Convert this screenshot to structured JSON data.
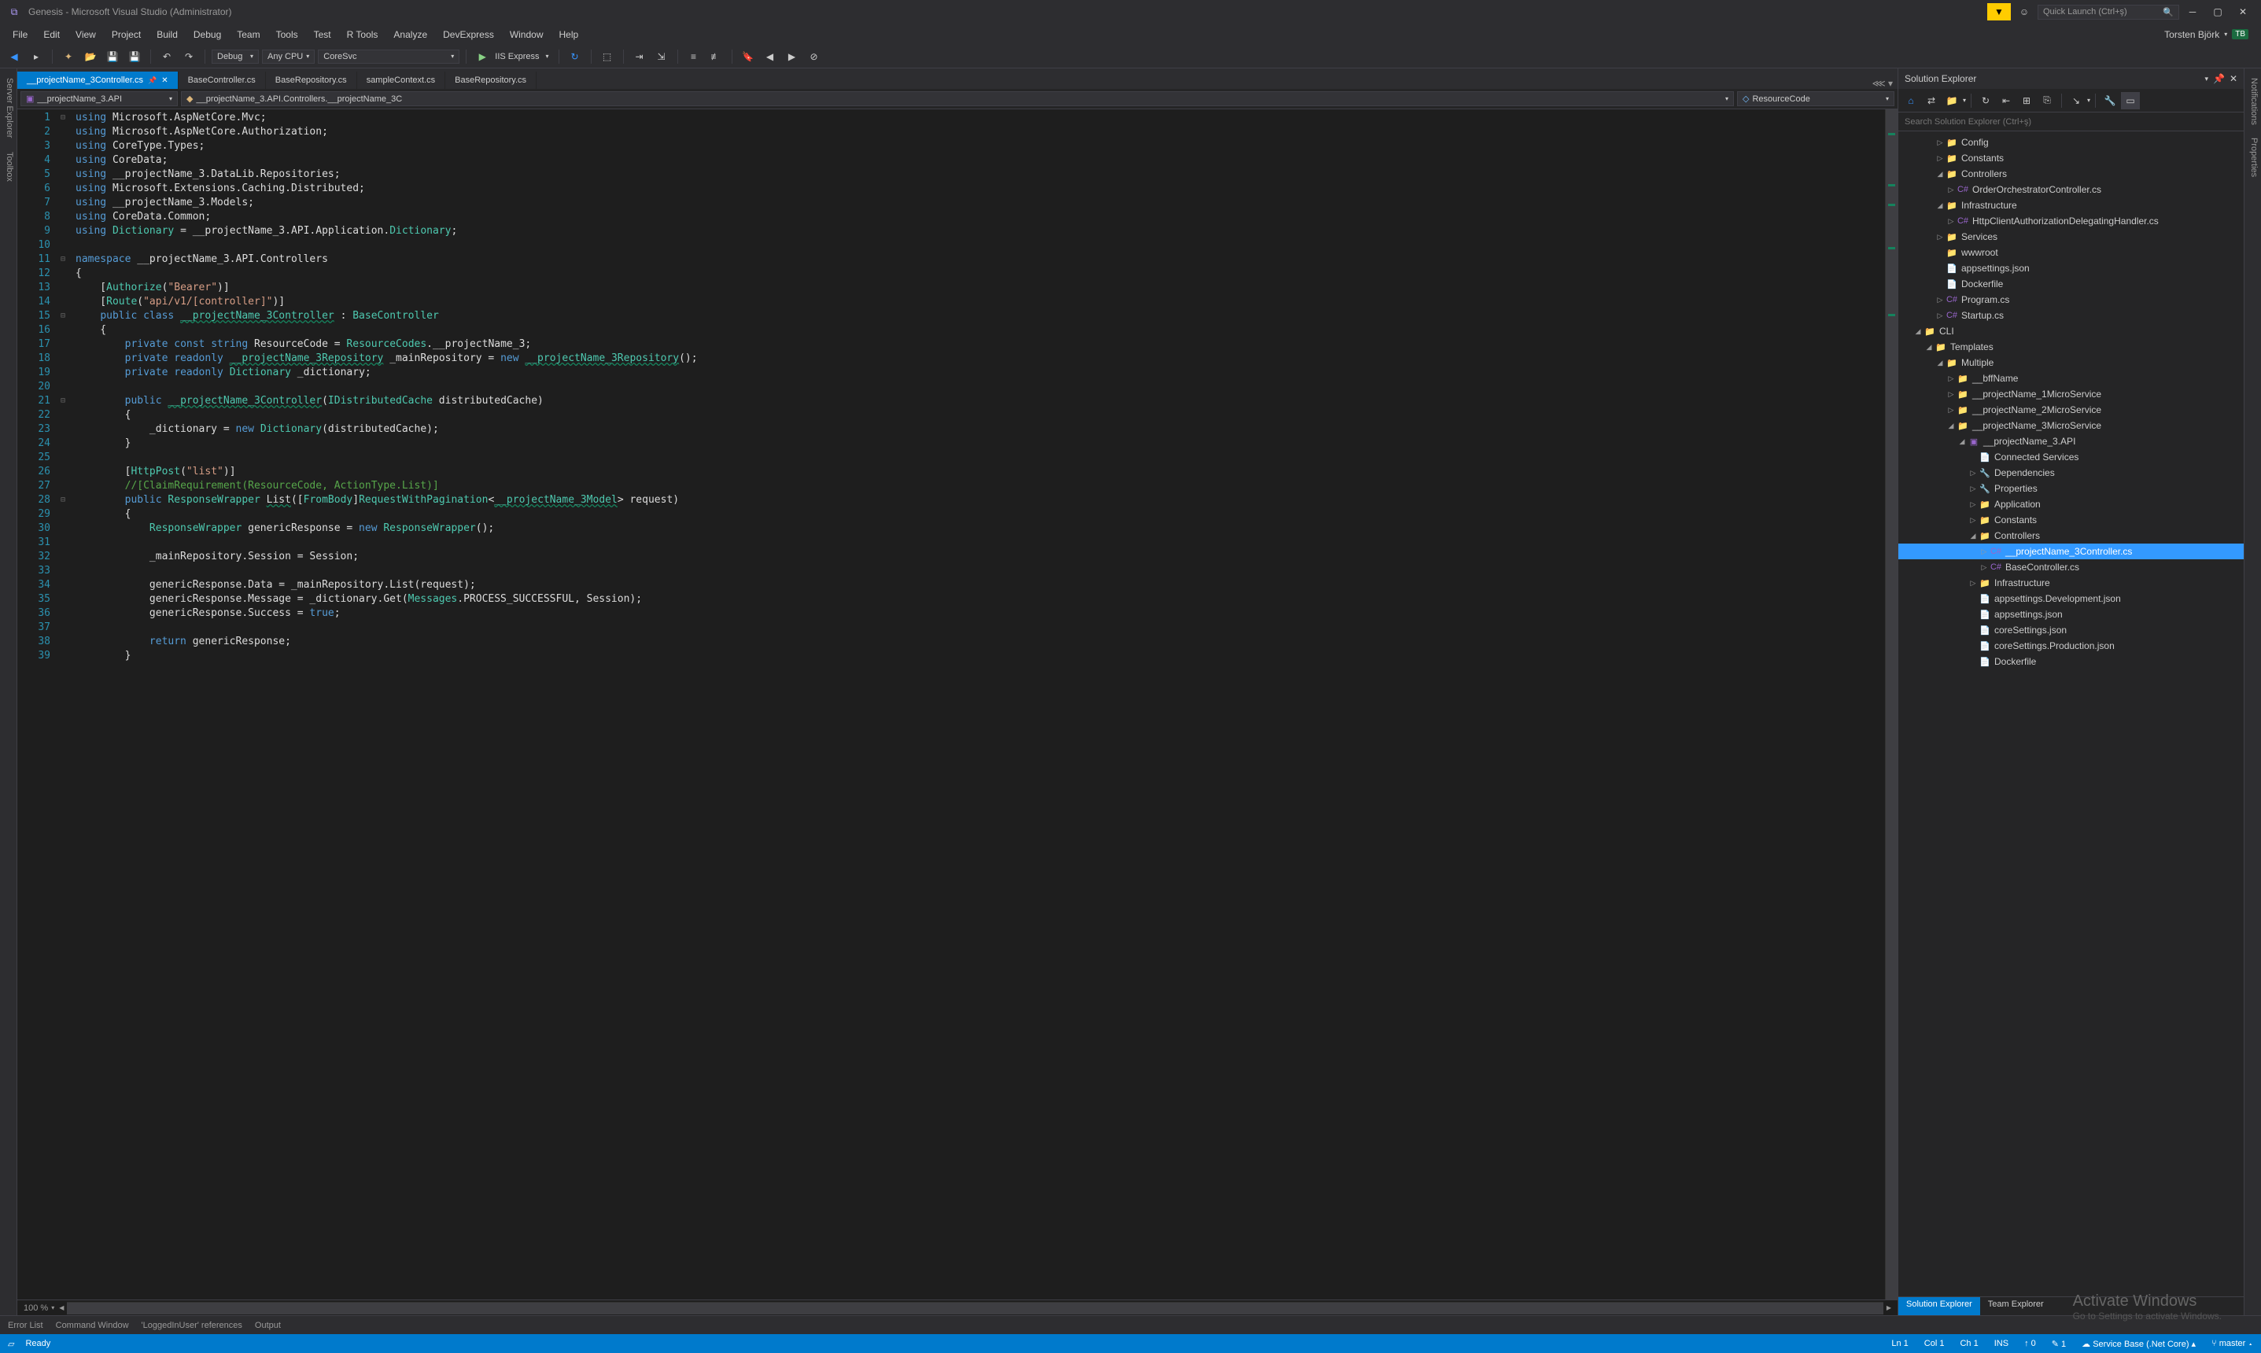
{
  "window": {
    "title": "Genesis - Microsoft Visual Studio  (Administrator)",
    "quick_launch_placeholder": "Quick Launch (Ctrl+ş)",
    "user_name": "Torsten Björk",
    "user_badge": "TB"
  },
  "menu": {
    "items": [
      "File",
      "Edit",
      "View",
      "Project",
      "Build",
      "Debug",
      "Team",
      "Tools",
      "Test",
      "R Tools",
      "Analyze",
      "DevExpress",
      "Window",
      "Help"
    ]
  },
  "toolbar": {
    "config": "Debug",
    "platform": "Any CPU",
    "startup_project": "CoreSvc",
    "run_label": "IIS Express"
  },
  "docs": {
    "tabs": [
      {
        "label": "__projectName_3Controller.cs",
        "active": true,
        "pinned": true
      },
      {
        "label": "BaseController.cs",
        "active": false
      },
      {
        "label": "BaseRepository.cs",
        "active": false
      },
      {
        "label": "sampleContext.cs",
        "active": false
      },
      {
        "label": "BaseRepository.cs",
        "active": false
      }
    ]
  },
  "navbar": {
    "scope": "__projectName_3.API",
    "class": "__projectName_3.API.Controllers.__projectName_3C",
    "member": "ResourceCode"
  },
  "code": {
    "lines": [
      {
        "n": 1,
        "fold": "⊟",
        "html": "<span class='kw'>using</span> Microsoft.AspNetCore.Mvc;"
      },
      {
        "n": 2,
        "html": "<span class='kw'>using</span> Microsoft.AspNetCore.Authorization;"
      },
      {
        "n": 3,
        "html": "<span class='kw'>using</span> CoreType.Types;"
      },
      {
        "n": 4,
        "html": "<span class='kw'>using</span> CoreData;"
      },
      {
        "n": 5,
        "html": "<span class='kw'>using</span> __projectName_3.DataLib.Repositories;"
      },
      {
        "n": 6,
        "html": "<span class='kw'>using</span> Microsoft.Extensions.Caching.Distributed;"
      },
      {
        "n": 7,
        "html": "<span class='kw'>using</span> __projectName_3.Models;"
      },
      {
        "n": 8,
        "html": "<span class='kw'>using</span> CoreData.Common;"
      },
      {
        "n": 9,
        "html": "<span class='kw'>using</span> <span class='type'>Dictionary</span> = __projectName_3.API.Application.<span class='type'>Dictionary</span>;"
      },
      {
        "n": 10,
        "html": ""
      },
      {
        "n": 11,
        "fold": "⊟",
        "html": "<span class='kw'>namespace</span> __projectName_3.API.Controllers"
      },
      {
        "n": 12,
        "html": "{"
      },
      {
        "n": 13,
        "html": "    [<span class='type'>Authorize</span>(<span class='str'>\"Bearer\"</span>)]"
      },
      {
        "n": 14,
        "html": "    [<span class='type'>Route</span>(<span class='str'>\"api/v1/[controller]\"</span>)]"
      },
      {
        "n": 15,
        "fold": "⊟",
        "html": "    <span class='kw'>public</span> <span class='kw'>class</span> <span class='type squiggle'>__projectName_3Controller</span> : <span class='type'>BaseController</span>"
      },
      {
        "n": 16,
        "html": "    {"
      },
      {
        "n": 17,
        "html": "        <span class='kw'>private</span> <span class='kw'>const</span> <span class='kw'>string</span> ResourceCode = <span class='type'>ResourceCodes</span>.__projectName_3;"
      },
      {
        "n": 18,
        "html": "        <span class='kw'>private</span> <span class='kw'>readonly</span> <span class='type squiggle'>__projectName_3Repository</span> _mainRepository = <span class='kw'>new</span> <span class='type squiggle'>__projectName_3Repository</span>();"
      },
      {
        "n": 19,
        "html": "        <span class='kw'>private</span> <span class='kw'>readonly</span> <span class='type'>Dictionary</span> _dictionary;"
      },
      {
        "n": 20,
        "html": ""
      },
      {
        "n": 21,
        "fold": "⊟",
        "html": "        <span class='kw'>public</span> <span class='type squiggle'>__projectName_3Controller</span>(<span class='type'>IDistributedCache</span> distributedCache)"
      },
      {
        "n": 22,
        "html": "        {"
      },
      {
        "n": 23,
        "html": "            _dictionary = <span class='kw'>new</span> <span class='type'>Dictionary</span>(distributedCache);"
      },
      {
        "n": 24,
        "html": "        }"
      },
      {
        "n": 25,
        "html": ""
      },
      {
        "n": 26,
        "html": "        [<span class='type'>HttpPost</span>(<span class='str'>\"list\"</span>)]"
      },
      {
        "n": 27,
        "html": "        <span class='com'>//[ClaimRequirement(ResourceCode, ActionType.List)]</span>"
      },
      {
        "n": 28,
        "fold": "⊟",
        "html": "        <span class='kw'>public</span> <span class='type'>ResponseWrapper</span> <span class='squiggle'>List</span>([<span class='type'>FromBody</span>]<span class='type'>RequestWithPagination</span>&lt;<span class='type squiggle'>__projectName_3Model</span>&gt; request)"
      },
      {
        "n": 29,
        "html": "        {"
      },
      {
        "n": 30,
        "html": "            <span class='type'>ResponseWrapper</span> genericResponse = <span class='kw'>new</span> <span class='type'>ResponseWrapper</span>();"
      },
      {
        "n": 31,
        "html": ""
      },
      {
        "n": 32,
        "html": "            _mainRepository.Session = Session;"
      },
      {
        "n": 33,
        "html": ""
      },
      {
        "n": 34,
        "html": "            genericResponse.Data = _mainRepository.List(request);"
      },
      {
        "n": 35,
        "html": "            genericResponse.Message = _dictionary.Get(<span class='type'>Messages</span>.PROCESS_SUCCESSFUL, Session);"
      },
      {
        "n": 36,
        "html": "            genericResponse.Success = <span class='kw'>true</span>;"
      },
      {
        "n": 37,
        "html": ""
      },
      {
        "n": 38,
        "html": "            <span class='kw'>return</span> genericResponse;"
      },
      {
        "n": 39,
        "html": "        }"
      }
    ]
  },
  "editor_status": {
    "zoom": "100 %"
  },
  "solution": {
    "header": "Solution Explorer",
    "search_placeholder": "Search Solution Explorer (Ctrl+ş)",
    "tree": [
      {
        "indent": 3,
        "exp": "▷",
        "icon": "folder",
        "label": "Config"
      },
      {
        "indent": 3,
        "exp": "▷",
        "icon": "folder",
        "label": "Constants"
      },
      {
        "indent": 3,
        "exp": "◢",
        "icon": "folder",
        "label": "Controllers"
      },
      {
        "indent": 4,
        "exp": "▷",
        "icon": "cs",
        "label": "OrderOrchestratorController.cs"
      },
      {
        "indent": 3,
        "exp": "◢",
        "icon": "folder",
        "label": "Infrastructure"
      },
      {
        "indent": 4,
        "exp": "▷",
        "icon": "cs",
        "label": "HttpClientAuthorizationDelegatingHandler.cs"
      },
      {
        "indent": 3,
        "exp": "▷",
        "icon": "folder",
        "label": "Services"
      },
      {
        "indent": 3,
        "exp": "",
        "icon": "folder",
        "label": "wwwroot"
      },
      {
        "indent": 3,
        "exp": "",
        "icon": "file",
        "label": "appsettings.json"
      },
      {
        "indent": 3,
        "exp": "",
        "icon": "file",
        "label": "Dockerfile"
      },
      {
        "indent": 3,
        "exp": "▷",
        "icon": "cs",
        "label": "Program.cs"
      },
      {
        "indent": 3,
        "exp": "▷",
        "icon": "cs",
        "label": "Startup.cs"
      },
      {
        "indent": 1,
        "exp": "◢",
        "icon": "folder",
        "label": "CLI"
      },
      {
        "indent": 2,
        "exp": "◢",
        "icon": "folder",
        "label": "Templates"
      },
      {
        "indent": 3,
        "exp": "◢",
        "icon": "folder",
        "label": "Multiple"
      },
      {
        "indent": 4,
        "exp": "▷",
        "icon": "folder",
        "label": "__bffName"
      },
      {
        "indent": 4,
        "exp": "▷",
        "icon": "folder",
        "label": "__projectName_1MicroService"
      },
      {
        "indent": 4,
        "exp": "▷",
        "icon": "folder",
        "label": "__projectName_2MicroService"
      },
      {
        "indent": 4,
        "exp": "◢",
        "icon": "folder",
        "label": "__projectName_3MicroService"
      },
      {
        "indent": 5,
        "exp": "◢",
        "icon": "proj",
        "label": "__projectName_3.API"
      },
      {
        "indent": 6,
        "exp": "",
        "icon": "file",
        "label": "Connected Services"
      },
      {
        "indent": 6,
        "exp": "▷",
        "icon": "prop",
        "label": "Dependencies"
      },
      {
        "indent": 6,
        "exp": "▷",
        "icon": "prop",
        "label": "Properties"
      },
      {
        "indent": 6,
        "exp": "▷",
        "icon": "folder",
        "label": "Application"
      },
      {
        "indent": 6,
        "exp": "▷",
        "icon": "folder",
        "label": "Constants"
      },
      {
        "indent": 6,
        "exp": "◢",
        "icon": "folder",
        "label": "Controllers"
      },
      {
        "indent": 7,
        "exp": "▷",
        "icon": "cs",
        "label": "__projectName_3Controller.cs",
        "selected": true
      },
      {
        "indent": 7,
        "exp": "▷",
        "icon": "cs",
        "label": "BaseController.cs"
      },
      {
        "indent": 6,
        "exp": "▷",
        "icon": "folder",
        "label": "Infrastructure"
      },
      {
        "indent": 6,
        "exp": "",
        "icon": "file",
        "label": "appsettings.Development.json"
      },
      {
        "indent": 6,
        "exp": "",
        "icon": "file",
        "label": "appsettings.json"
      },
      {
        "indent": 6,
        "exp": "",
        "icon": "file",
        "label": "coreSettings.json"
      },
      {
        "indent": 6,
        "exp": "",
        "icon": "file",
        "label": "coreSettings.Production.json"
      },
      {
        "indent": 6,
        "exp": "",
        "icon": "file",
        "label": "Dockerfile"
      }
    ],
    "bottom_tabs": [
      "Solution Explorer",
      "Team Explorer"
    ]
  },
  "side_tabs": {
    "left": [
      "Server Explorer",
      "Toolbox"
    ],
    "right": [
      "Notifications",
      "Properties"
    ]
  },
  "bottom_tabs": [
    "Error List",
    "Command Window",
    "'LoggedInUser' references",
    "Output"
  ],
  "status": {
    "ready": "Ready",
    "ln": "Ln 1",
    "col": "Col 1",
    "ch": "Ch 1",
    "ins": "INS",
    "publish": "Service Base (.Net Core)",
    "branch": "master"
  },
  "watermark": {
    "title": "Activate Windows",
    "sub": "Go to Settings to activate Windows."
  }
}
